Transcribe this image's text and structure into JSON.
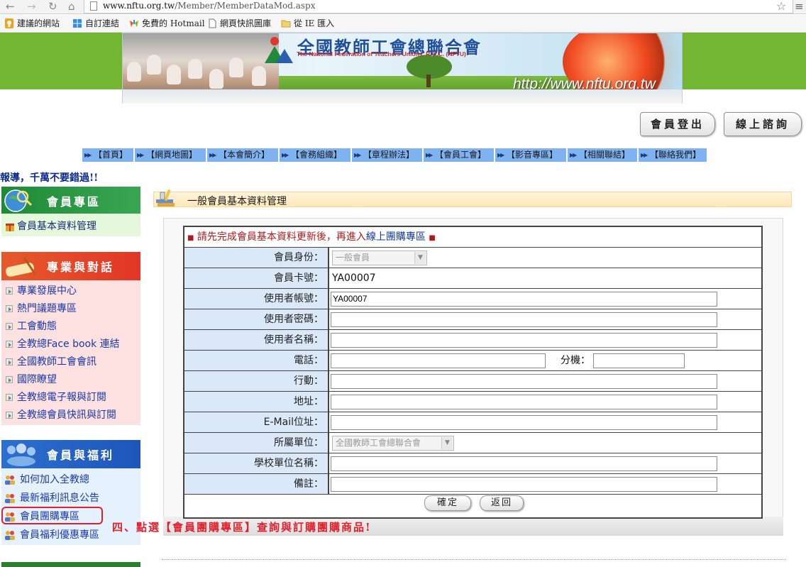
{
  "browser": {
    "url_host": "www.nftu.org.tw",
    "url_path": "/Member/MemberDataMod.aspx",
    "bookmarks": [
      "建議的網站",
      "自訂連結",
      "免費的 Hotmail",
      "網頁快訊圖庫",
      "從 IE 匯入"
    ]
  },
  "banner": {
    "title": "全國教師工會總聯合會",
    "subtitle": "The National Federation of Teachers Unions, R.O.C. (NFTU)",
    "url": "http://www.nftu.org.tw"
  },
  "top_buttons": {
    "logout": "會員登出",
    "query": "線上諮詢"
  },
  "nav": [
    "【首頁】",
    "【網頁地圖】",
    "【本會簡介】",
    "【會務組織】",
    "【章程辦法】",
    "【會員工會】",
    "【影音專區】",
    "【相關聯結】",
    "【聯絡我們】"
  ],
  "marquee": "報導，千萬不要錯過!!",
  "sidebar": {
    "member_zone": {
      "title": "會員專區",
      "items": [
        "會員基本資料管理"
      ]
    },
    "professional": {
      "title": "專業與對話",
      "items": [
        "專業發展中心",
        "熱門議題專區",
        "工會動態",
        "全教總Face book 連結",
        "全國教師工會會訊",
        "國際瞭望",
        "全教總電子報與訂閱",
        "全教總會員快訊與訂閱"
      ]
    },
    "welfare": {
      "title": "會員與福利",
      "items": [
        "如何加入全教總",
        "最新福利訊息公告",
        "會員團購專區",
        "會員福利優惠專區"
      ]
    }
  },
  "annotation": "四、點選【會員團購專區】查詢與訂購團購商品!",
  "section_title": "一般會員基本資料管理",
  "form": {
    "notice_prefix": "請先完成會員基本資料更新後，再進入",
    "notice_link": "線上團購專區",
    "identity_label": "會員身份：",
    "identity_value": "一般會員",
    "card_label": "會員卡號：",
    "card_value": "YA00007",
    "account_label": "使用者帳號：",
    "account_value": "YA00007",
    "password_label": "使用者密碼：",
    "name_label": "使用者名稱：",
    "phone_label": "電話：",
    "ext_label": "分機：",
    "mobile_label": "行動：",
    "address_label": "地址：",
    "email_label": "E-Mail位址：",
    "unit_label": "所屬單位：",
    "unit_value": "全國教師工會總聯合會",
    "school_label": "學校單位名稱：",
    "remark_label": "備註：",
    "confirm": "確定",
    "back": "返回"
  },
  "colors": {
    "nav_bg": "#7fb2f0",
    "label_bg": "#dbe8f8",
    "annotation": "#e0202c",
    "link": "#1a39a8"
  }
}
